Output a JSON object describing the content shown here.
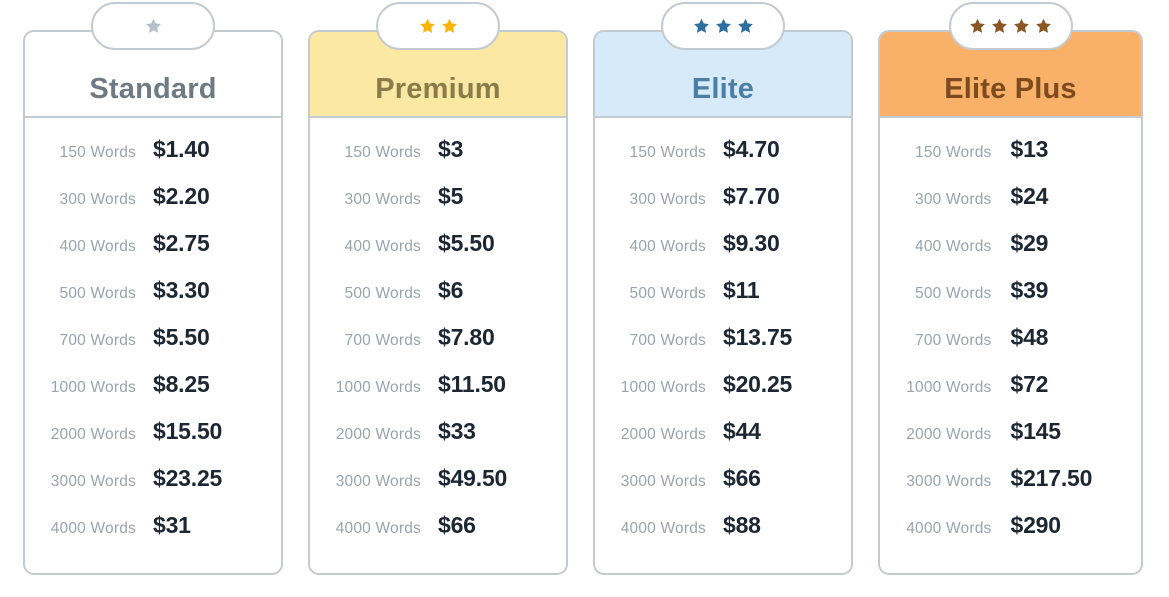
{
  "meta": {
    "component": "pricing-plans-table",
    "row_label_suffix": "Words",
    "currency_symbol": "$"
  },
  "colors": {
    "card_border": "#c3cad0",
    "badge_border": "#c3cad0",
    "words_label": "#9aa3ab",
    "price_text": "#1d2733",
    "standard_header_bg": "#ffffff",
    "standard_title": "#6e7b85",
    "standard_star": "#b7c0c7",
    "premium_header_bg": "#fbe8a2",
    "premium_title": "#8a7b4a",
    "premium_star": "#ffb400",
    "elite_header_bg": "#d7eafa",
    "elite_title": "#4b7fa6",
    "elite_star": "#2f6f9f",
    "eliteplus_header_bg": "#f9b069",
    "eliteplus_title": "#7b4a1f",
    "eliteplus_star": "#8a5624"
  },
  "plans": [
    {
      "id": "standard",
      "title": "Standard",
      "stars": 1,
      "rows": [
        {
          "words": "150 Words",
          "price": "$1.40"
        },
        {
          "words": "300 Words",
          "price": "$2.20"
        },
        {
          "words": "400 Words",
          "price": "$2.75"
        },
        {
          "words": "500 Words",
          "price": "$3.30"
        },
        {
          "words": "700 Words",
          "price": "$5.50"
        },
        {
          "words": "1000 Words",
          "price": "$8.25"
        },
        {
          "words": "2000 Words",
          "price": "$15.50"
        },
        {
          "words": "3000 Words",
          "price": "$23.25"
        },
        {
          "words": "4000 Words",
          "price": "$31"
        }
      ]
    },
    {
      "id": "premium",
      "title": "Premium",
      "stars": 2,
      "rows": [
        {
          "words": "150 Words",
          "price": "$3"
        },
        {
          "words": "300 Words",
          "price": "$5"
        },
        {
          "words": "400 Words",
          "price": "$5.50"
        },
        {
          "words": "500 Words",
          "price": "$6"
        },
        {
          "words": "700 Words",
          "price": "$7.80"
        },
        {
          "words": "1000 Words",
          "price": "$11.50"
        },
        {
          "words": "2000 Words",
          "price": "$33"
        },
        {
          "words": "3000 Words",
          "price": "$49.50"
        },
        {
          "words": "4000 Words",
          "price": "$66"
        }
      ]
    },
    {
      "id": "elite",
      "title": "Elite",
      "stars": 3,
      "rows": [
        {
          "words": "150 Words",
          "price": "$4.70"
        },
        {
          "words": "300 Words",
          "price": "$7.70"
        },
        {
          "words": "400 Words",
          "price": "$9.30"
        },
        {
          "words": "500 Words",
          "price": "$11"
        },
        {
          "words": "700 Words",
          "price": "$13.75"
        },
        {
          "words": "1000 Words",
          "price": "$20.25"
        },
        {
          "words": "2000 Words",
          "price": "$44"
        },
        {
          "words": "3000 Words",
          "price": "$66"
        },
        {
          "words": "4000 Words",
          "price": "$88"
        }
      ]
    },
    {
      "id": "eliteplus",
      "title": "Elite Plus",
      "stars": 4,
      "rows": [
        {
          "words": "150 Words",
          "price": "$13"
        },
        {
          "words": "300 Words",
          "price": "$24"
        },
        {
          "words": "400 Words",
          "price": "$29"
        },
        {
          "words": "500 Words",
          "price": "$39"
        },
        {
          "words": "700 Words",
          "price": "$48"
        },
        {
          "words": "1000 Words",
          "price": "$72"
        },
        {
          "words": "2000 Words",
          "price": "$145"
        },
        {
          "words": "3000 Words",
          "price": "$217.50"
        },
        {
          "words": "4000 Words",
          "price": "$290"
        }
      ]
    }
  ]
}
